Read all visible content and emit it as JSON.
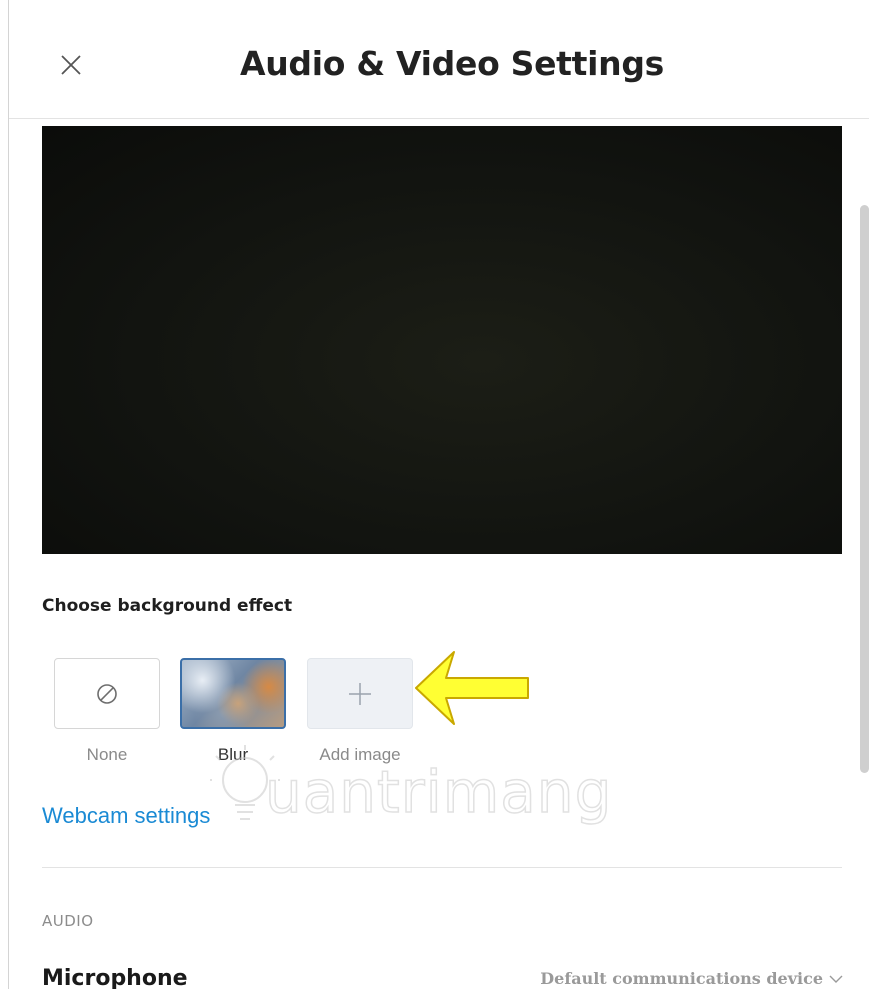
{
  "dialog": {
    "title": "Audio & Video Settings"
  },
  "background_effect": {
    "heading": "Choose background effect",
    "options": [
      {
        "label": "None",
        "icon": "no-symbol-icon",
        "selected": false
      },
      {
        "label": "Blur",
        "icon": "blur-preview",
        "selected": true
      },
      {
        "label": "Add image",
        "icon": "plus-icon",
        "selected": false
      }
    ]
  },
  "webcam": {
    "link_label": "Webcam settings"
  },
  "audio": {
    "section_label": "AUDIO",
    "microphone_label": "Microphone",
    "microphone_value": "Default communications device"
  },
  "watermark": {
    "text": "uantrimang"
  },
  "colors": {
    "accent": "#1a8ad4",
    "selected_border": "#3b6fa8",
    "arrow_fill": "#ffff33",
    "arrow_stroke": "#c9a800"
  }
}
